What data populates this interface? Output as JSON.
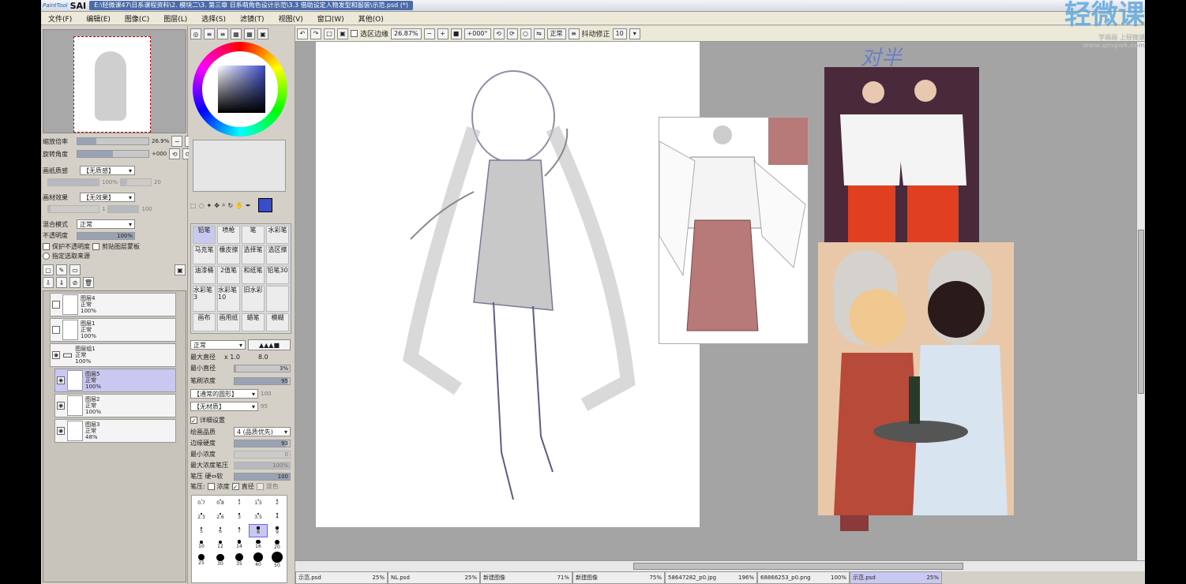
{
  "title": {
    "app": "SAI",
    "brand": "PaintTool",
    "path": "E:\\轻微课47\\日系课程资料\\2. 模块二\\3. 第三章 日系萌角色设计示范\\3.3 借助设定人物发型和服装\\示范.psd (*)"
  },
  "menu": [
    "文件(F)",
    "编辑(E)",
    "图像(C)",
    "图层(L)",
    "选择(S)",
    "滤镜(T)",
    "视图(V)",
    "窗口(W)",
    "其他(O)"
  ],
  "toolbar": {
    "selection_edge": "选区边缘",
    "zoom": "26.87%",
    "angle": "+000°",
    "mode": "正常",
    "stabilizer_label": "抖动修正",
    "stabilizer": "10"
  },
  "nav": {
    "zoom_label": "缩放倍率",
    "zoom": "26.9%",
    "angle_label": "旋转角度",
    "angle": "+000"
  },
  "texture": {
    "paper_label": "画纸质感",
    "paper": "【无质感】",
    "paper_val": "100%",
    "paper_val2": "20",
    "effect_label": "画材效果",
    "effect": "【无效果】",
    "effect_val": "1",
    "effect_val2": "100"
  },
  "blend": {
    "label": "混合模式",
    "value": "正常",
    "opacity_label": "不透明度",
    "opacity": "100%",
    "protect": "保护不透明度",
    "clip": "剪贴图层蒙板",
    "source": "指定选取来源"
  },
  "layers": [
    {
      "name": "图层4",
      "mode": "正常",
      "op": "100%"
    },
    {
      "name": "图层1",
      "mode": "正常",
      "op": "100%"
    },
    {
      "name": "图层组1",
      "mode": "正常",
      "op": "100%"
    },
    {
      "name": "图层5",
      "mode": "正常",
      "op": "100%"
    },
    {
      "name": "图层2",
      "mode": "正常",
      "op": "100%"
    },
    {
      "name": "图层3",
      "mode": "正常",
      "op": "48%"
    }
  ],
  "tools": [
    "铅笔",
    "喷枪",
    "笔",
    "水彩笔",
    "马克笔",
    "橡皮擦",
    "选择笔",
    "选区擦",
    "油漆桶",
    "2值笔",
    "和纸笔",
    "铅笔30",
    "水彩笔3",
    "水彩笔10",
    "旧水彩",
    "",
    "画布",
    "画用纸",
    "蜡笔",
    "模糊"
  ],
  "brush": {
    "mode": "正常",
    "max_label": "最大直径",
    "max": "x 1.0",
    "max_val": "8.0",
    "min_label": "最小直径",
    "min": "3%",
    "density_label": "笔刷浓度",
    "density": "95",
    "shape": "【通常的圆形】",
    "shape_val": "100",
    "tex": "【无材质】",
    "tex_val": "95",
    "detail": "详细设置",
    "quality_label": "绘画品质",
    "quality": "4 (品质优先)",
    "edge_label": "边缘硬度",
    "edge": "93",
    "min_density_label": "最小浓度",
    "min_density": "0",
    "max_press_label": "最大浓度笔压",
    "max_press": "100%",
    "pressure_label": "笔压 硬⇔软",
    "pressure": "100",
    "press_opts": "笔压:",
    "press_density": "浓度",
    "press_size": "直径",
    "press_blend": "混色"
  },
  "brush_sizes": [
    "0.7",
    "0.8",
    "1",
    "1.5",
    "2",
    "2.3",
    "2.6",
    "3",
    "3.5",
    "4",
    "5",
    "6",
    "7",
    "8",
    "9",
    "10",
    "12",
    "14",
    "16",
    "20",
    "25",
    "30",
    "35",
    "40",
    "50"
  ],
  "tabs": [
    {
      "name": "示范.psd",
      "pct": "25%"
    },
    {
      "name": "NL.psd",
      "pct": "25%"
    },
    {
      "name": "新建图像",
      "pct": "71%"
    },
    {
      "name": "新建图像",
      "pct": "75%"
    },
    {
      "name": "58647282_p0.jpg",
      "pct": "196%"
    },
    {
      "name": "68866253_p0.png",
      "pct": "100%"
    },
    {
      "name": "示范.psd",
      "pct": "25%"
    }
  ],
  "watermark": {
    "brand": "轻微课",
    "sub": "学画画 上轻微课",
    "url": "www.qingwk.com"
  },
  "annotation": "对半",
  "colors": {
    "accent": "#3a4cc8",
    "selected": "#c8c8f0"
  }
}
